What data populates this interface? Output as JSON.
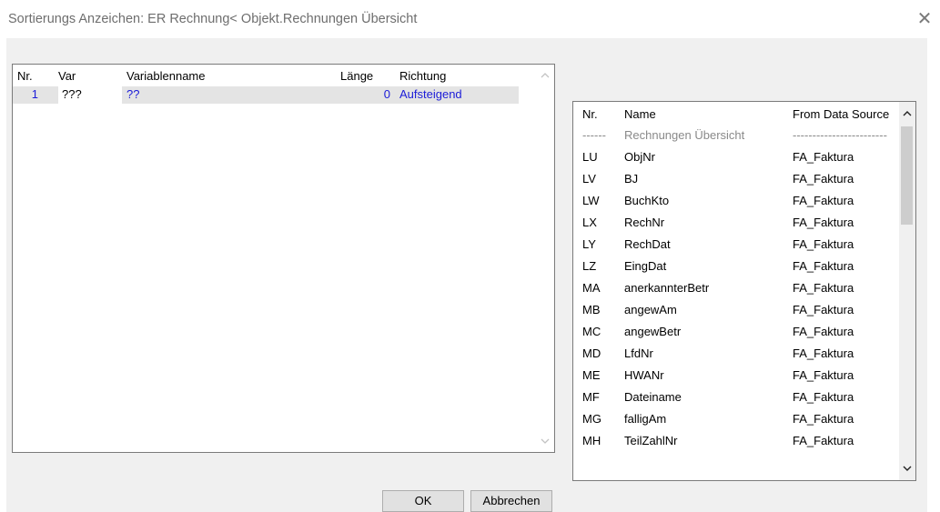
{
  "window": {
    "title": "Sortierungs Anzeichen: ER Rechnung< Objekt.Rechnungen Übersicht"
  },
  "left_table": {
    "columns": [
      "Nr.",
      "Var",
      "Variablenname",
      "Länge",
      "Richtung"
    ],
    "rows": [
      {
        "nr": "1",
        "var": "???",
        "name": "??",
        "length": "0",
        "direction": "Aufsteigend"
      }
    ]
  },
  "right_table": {
    "columns": [
      "Nr.",
      "Name",
      "From Data Source"
    ],
    "rows": [
      {
        "nr": "------",
        "name": "Rechnungen Übersicht",
        "source": "------------------------"
      },
      {
        "nr": "LU",
        "name": "ObjNr",
        "source": "FA_Faktura"
      },
      {
        "nr": "LV",
        "name": "BJ",
        "source": "FA_Faktura"
      },
      {
        "nr": "LW",
        "name": "BuchKto",
        "source": "FA_Faktura"
      },
      {
        "nr": "LX",
        "name": "RechNr",
        "source": "FA_Faktura"
      },
      {
        "nr": "LY",
        "name": "RechDat",
        "source": "FA_Faktura"
      },
      {
        "nr": "LZ",
        "name": "EingDat",
        "source": "FA_Faktura"
      },
      {
        "nr": "MA",
        "name": "anerkannterBetr",
        "source": "FA_Faktura"
      },
      {
        "nr": "MB",
        "name": "angewAm",
        "source": "FA_Faktura"
      },
      {
        "nr": "MC",
        "name": "angewBetr",
        "source": "FA_Faktura"
      },
      {
        "nr": "MD",
        "name": "LfdNr",
        "source": "FA_Faktura"
      },
      {
        "nr": "ME",
        "name": "HWANr",
        "source": "FA_Faktura"
      },
      {
        "nr": "MF",
        "name": "Dateiname",
        "source": "FA_Faktura"
      },
      {
        "nr": "MG",
        "name": "falligAm",
        "source": "FA_Faktura"
      },
      {
        "nr": "MH",
        "name": "TeilZahlNr",
        "source": "FA_Faktura"
      }
    ]
  },
  "buttons": {
    "ok": "OK",
    "cancel": "Abbrechen"
  },
  "icons": {
    "close": "close-icon"
  },
  "colors": {
    "value_blue": "#1c1cd8",
    "selected_row": "#e4e4e4",
    "placeholder_grey": "#8a8a8a"
  }
}
